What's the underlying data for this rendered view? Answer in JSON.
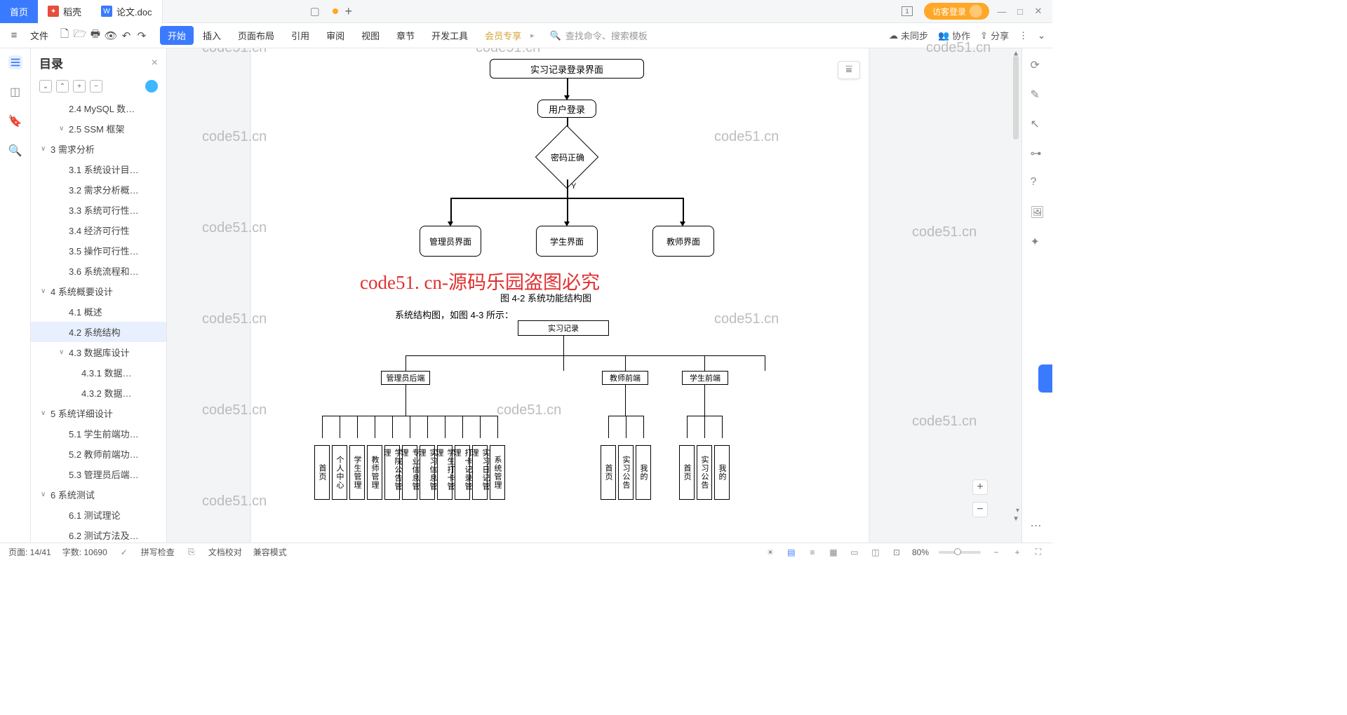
{
  "titlebar": {
    "home": "首页",
    "dao": "稻壳",
    "doc": "论文.doc",
    "login": "访客登录"
  },
  "menubar": {
    "file": "文件",
    "start": "开始",
    "insert": "插入",
    "layout": "页面布局",
    "ref": "引用",
    "review": "审阅",
    "view": "视图",
    "chapter": "章节",
    "devtool": "开发工具",
    "vip": "会员专享",
    "search_placeholder": "查找命令、搜索模板",
    "unsync": "未同步",
    "collab": "协作",
    "share": "分享"
  },
  "toc": {
    "title": "目录",
    "items": [
      {
        "lvl": 2,
        "arrow": "",
        "t": "2.4 MySQL 数…"
      },
      {
        "lvl": 2,
        "arrow": "∨",
        "t": "2.5 SSM 框架"
      },
      {
        "lvl": 1,
        "arrow": "∨",
        "t": "3  需求分析"
      },
      {
        "lvl": 2,
        "arrow": "",
        "t": "3.1  系统设计目…"
      },
      {
        "lvl": 2,
        "arrow": "",
        "t": "3.2 需求分析概…"
      },
      {
        "lvl": 2,
        "arrow": "",
        "t": "3.3  系统可行性…"
      },
      {
        "lvl": 2,
        "arrow": "",
        "t": "3.4 经济可行性"
      },
      {
        "lvl": 2,
        "arrow": "",
        "t": "3.5 操作可行性…"
      },
      {
        "lvl": 2,
        "arrow": "",
        "t": "3.6 系统流程和…"
      },
      {
        "lvl": 1,
        "arrow": "∨",
        "t": "4 系统概要设计"
      },
      {
        "lvl": 2,
        "arrow": "",
        "t": "4.1  概述"
      },
      {
        "lvl": 2,
        "arrow": "",
        "t": "4.2  系统结构",
        "sel": true
      },
      {
        "lvl": 2,
        "arrow": "∨",
        "t": "4.3  数据库设计"
      },
      {
        "lvl": 3,
        "arrow": "",
        "t": "4.3.1  数据…"
      },
      {
        "lvl": 3,
        "arrow": "",
        "t": "4.3.2  数据…"
      },
      {
        "lvl": 1,
        "arrow": "∨",
        "t": "5 系统详细设计"
      },
      {
        "lvl": 2,
        "arrow": "",
        "t": "5.1 学生前端功…"
      },
      {
        "lvl": 2,
        "arrow": "",
        "t": "5.2 教师前端功…"
      },
      {
        "lvl": 2,
        "arrow": "",
        "t": "5.3 管理员后端…"
      },
      {
        "lvl": 1,
        "arrow": "∨",
        "t": "6  系统测试"
      },
      {
        "lvl": 2,
        "arrow": "",
        "t": "6.1 测试理论"
      },
      {
        "lvl": 2,
        "arrow": "",
        "t": "6.2 测试方法及…"
      }
    ]
  },
  "doc": {
    "flow": {
      "b1": "实习记录登录界面",
      "b2": "用户登录",
      "b3": "密码正确",
      "y": "Y",
      "b4": "管理员界面",
      "b5": "学生界面",
      "b6": "教师界面"
    },
    "redtext": "code51. cn-源码乐园盗图必究",
    "caption1": "图 4-2 系统功能结构图",
    "caption2": "系统结构图，如图 4-3 所示：",
    "tree": {
      "root": "实习记录",
      "n1": "管理员后端",
      "n2": "教师前端",
      "n3": "学生前端",
      "leaves1": [
        "首页",
        "个人中心",
        "学生管理",
        "教师管理",
        "学院公告管理",
        "专业信息管理",
        "实习信息管理",
        "学生打卡管理",
        "打卡记录管理",
        "实习日记管理",
        "系统管理"
      ],
      "leaves2": [
        "首页",
        "实习公告",
        "我的"
      ],
      "leaves3": [
        "首页",
        "实习公告",
        "我的"
      ]
    },
    "watermarks": [
      "code51.cn",
      "code51.cn",
      "code51.cn",
      "code51.cn",
      "code51.cn",
      "code51.cn",
      "code51.cn",
      "code51.cn",
      "code51.cn",
      "code51.cn",
      "code51.cn",
      "code51.cn"
    ]
  },
  "status": {
    "page": "页面: 14/41",
    "words": "字数: 10690",
    "spell": "拼写检查",
    "proof": "文档校对",
    "compat": "兼容模式",
    "zoom": "80%"
  }
}
